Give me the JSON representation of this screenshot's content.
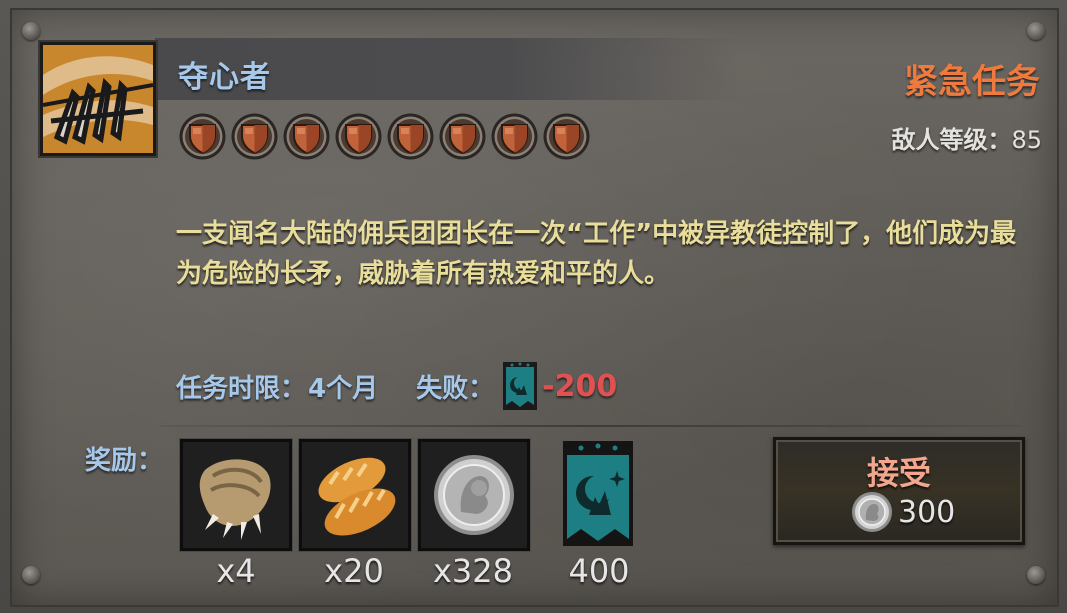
{
  "quest": {
    "title": "夺心者",
    "urgent_tag": "紧急任务",
    "enemy_level_label": "敌人等级：",
    "enemy_level_value": "85",
    "difficulty_stars": 8,
    "description": "一支闻名大陆的佣兵团团长在一次“工作”中被异教徒控制了，他们成为最为危险的长矛，威胁着所有热爱和平的人。",
    "time_limit_label": "任务时限：",
    "time_limit_value": "4个月",
    "fail_label": "失败：",
    "fail_penalty": "-200"
  },
  "rewards": {
    "label": "奖励：",
    "items": [
      {
        "icon": "beast-paw-icon",
        "qty": "x4"
      },
      {
        "icon": "bread-icon",
        "qty": "x20"
      },
      {
        "icon": "silver-coin-icon",
        "qty": "x328"
      },
      {
        "icon": "faction-banner-icon",
        "qty": "400"
      }
    ]
  },
  "accept": {
    "label": "接受",
    "cost": "300",
    "cost_icon": "silver-coin-icon"
  },
  "colors": {
    "title_blue": "#a6c8ea",
    "urgent_orange": "#ee7a3e",
    "desc_yellow": "#e8dd9a",
    "penalty_red": "#e05252",
    "accept_pink": "#f2a68e",
    "banner_teal": "#1d7f84"
  }
}
